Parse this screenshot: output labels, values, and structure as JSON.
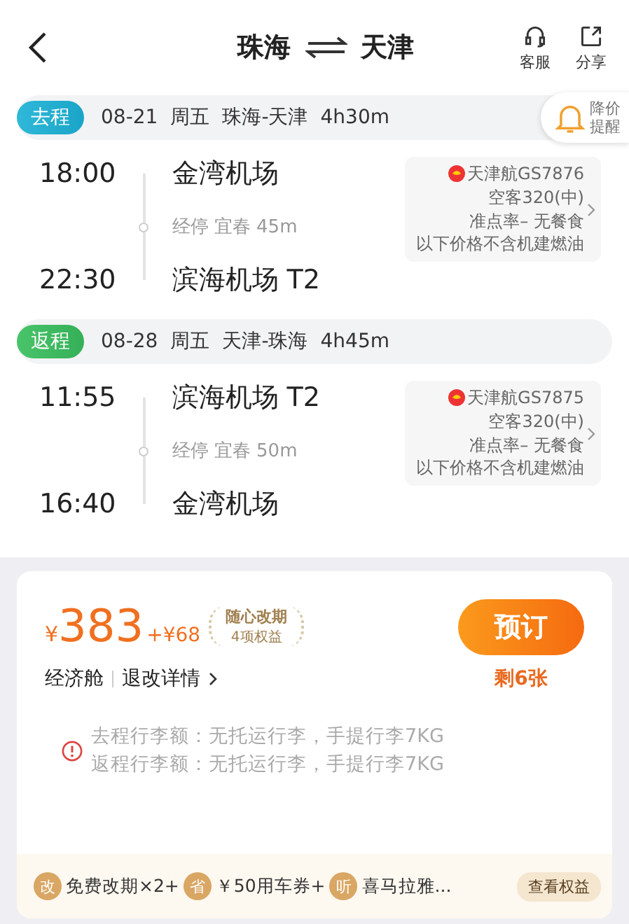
{
  "header": {
    "from": "珠海",
    "to": "天津",
    "actions": [
      {
        "kind": "service",
        "label": "客服"
      },
      {
        "kind": "share",
        "label": "分享"
      }
    ]
  },
  "price_alert": {
    "lines": [
      "降价",
      "提醒"
    ]
  },
  "legs": [
    {
      "kind": "outbound",
      "tag": "去程",
      "date": "08-21",
      "weekday": "周五",
      "route": "珠海-天津",
      "duration": "4h30m",
      "depart_time": "18:00",
      "depart_airport": "金湾机场",
      "stop": "经停 宜春 45m",
      "arrive_time": "22:30",
      "arrive_airport": "滨海机场 T2",
      "flight": {
        "airline": "天津航GS7876",
        "aircraft": "空客320(中)",
        "info": "准点率– 无餐食",
        "note": "以下价格不含机建燃油"
      }
    },
    {
      "kind": "return",
      "tag": "返程",
      "date": "08-28",
      "weekday": "周五",
      "route": "天津-珠海",
      "duration": "4h45m",
      "depart_time": "11:55",
      "depart_airport": "滨海机场 T2",
      "stop": "经停 宜春 50m",
      "arrive_time": "16:40",
      "arrive_airport": "金湾机场",
      "flight": {
        "airline": "天津航GS7875",
        "aircraft": "空客320(中)",
        "info": "准点率– 无餐食",
        "note": "以下价格不含机建燃油"
      }
    }
  ],
  "offer": {
    "currency": "¥",
    "price": "383",
    "extra": "+¥68",
    "badge_title": "随心改期",
    "badge_sub": "4项权益",
    "cabin": "经济舱",
    "rules_link": "退改详情",
    "book": "预订",
    "remaining": "剩6张",
    "baggage": [
      "去程行李额：无托运行李，手提行李7KG",
      "返程行李额：无托运行李，手提行李7KG"
    ],
    "perks": [
      {
        "icon": "改",
        "label": "免费改期×2+"
      },
      {
        "icon": "省",
        "label": "￥50用车券+"
      },
      {
        "icon": "听",
        "label": "喜马拉雅..."
      }
    ],
    "perks_link": "查看权益"
  }
}
